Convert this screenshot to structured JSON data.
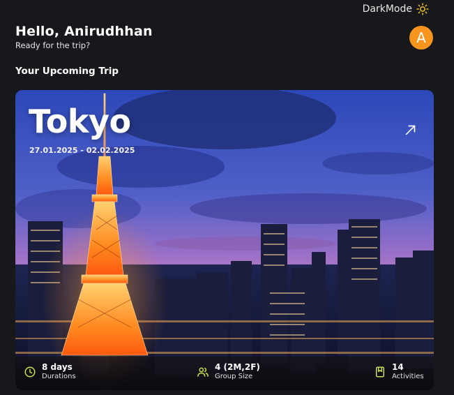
{
  "header": {
    "theme_toggle_label": "DarkMode",
    "theme_icon": "sun-icon",
    "avatar_initial": "A",
    "avatar_color": "#f7941d"
  },
  "greeting": {
    "title": "Hello, Anirudhhan",
    "subtitle": "Ready for the trip?"
  },
  "section": {
    "title": "Your Upcoming Trip"
  },
  "trip": {
    "city": "Tokyo",
    "dates": "27.01.2025 - 02.02.2025",
    "open_icon": "arrow-up-right-icon",
    "stats": [
      {
        "icon": "clock-icon",
        "value": "8 days",
        "label": "Durations"
      },
      {
        "icon": "group-icon",
        "value": "4 (2M,2F)",
        "label": "Group Size"
      },
      {
        "icon": "bookmark-icon",
        "value": "14",
        "label": "Activities"
      }
    ],
    "accent_color": "#c9e24a"
  }
}
